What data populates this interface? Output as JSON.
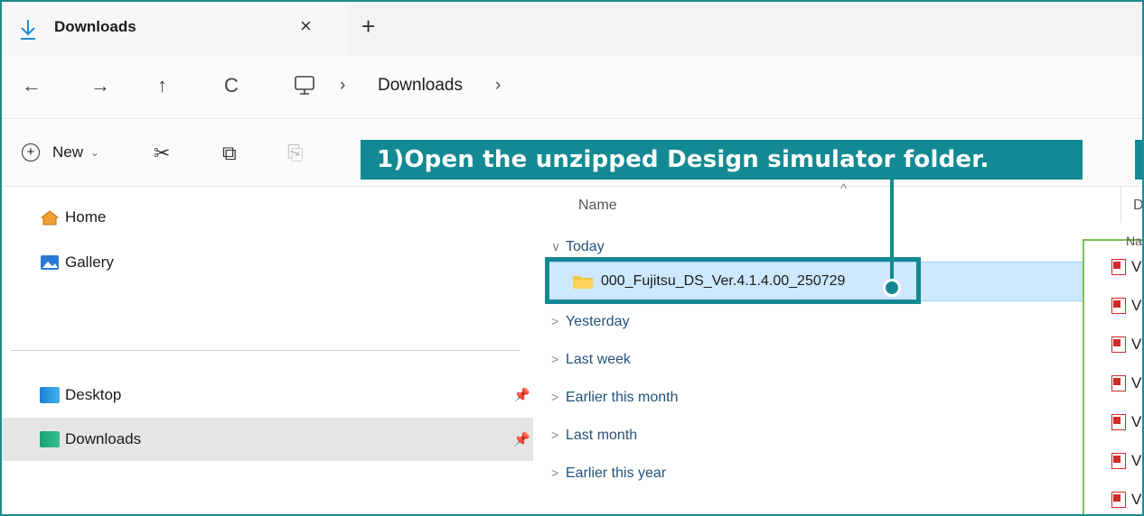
{
  "tab": {
    "title": "Downloads",
    "close": "×",
    "add": "+"
  },
  "nav": {
    "back": "←",
    "forward": "→",
    "up": "↑",
    "refresh": "C",
    "separator": "›",
    "crumb": "Downloads"
  },
  "toolbar": {
    "new_label": "New",
    "plus": "+",
    "chevron": "⌄",
    "cut": "✂",
    "copy": "⧉",
    "paste": "⎘"
  },
  "callout": {
    "text": "1)Open the unzipped Design simulator folder."
  },
  "navpane": {
    "home": "Home",
    "gallery": "Gallery",
    "desktop": "Desktop",
    "downloads": "Downloads",
    "pin": "📌"
  },
  "filelist": {
    "col_name": "Name",
    "col_d": "D",
    "sort_caret": "^",
    "chev_open": "∨",
    "chev_closed": ">",
    "groups": [
      "Today",
      "Yesterday",
      "Last week",
      "Earlier this month",
      "Last month",
      "Earlier this year"
    ],
    "selected_file": "000_Fujitsu_DS_Ver.4.1.4.00_250729"
  },
  "side_panel": {
    "header": "Na",
    "rows": [
      "V",
      "V",
      "V",
      "V",
      "V",
      "V",
      "V"
    ]
  },
  "colors": {
    "accent": "#138a93",
    "selection": "#cde8ff",
    "side_border": "#7ac05a"
  }
}
